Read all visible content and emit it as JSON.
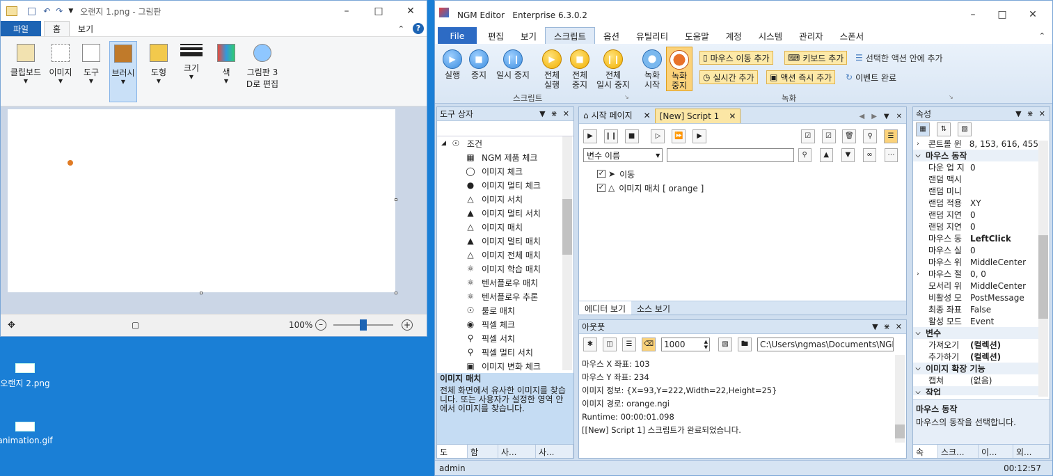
{
  "desktop": {
    "icons": [
      {
        "label": "오랜지 2.png"
      },
      {
        "label": "animation.gif"
      }
    ]
  },
  "paint": {
    "title": "오랜지 1.png - 그림판",
    "tabs": {
      "file": "파일",
      "home": "홈",
      "view": "보기"
    },
    "ribbon": {
      "clipboard": "클립보드",
      "image": "이미지",
      "tools": "도구",
      "brushes": "브러시",
      "shapes": "도형",
      "size": "크기",
      "colors": "색",
      "paint3d_line1": "그림판 3",
      "paint3d_line2": "D로 편집"
    },
    "status": {
      "zoom": "100%"
    },
    "dot_color": "#e07b24"
  },
  "ngm": {
    "title": "NGM Editor   Enterprise 6.3.0.2",
    "menu": [
      "File",
      "편집",
      "보기",
      "스크립트",
      "옵션",
      "유틸리티",
      "도움말",
      "계정",
      "시스템",
      "관리자",
      "스폰서"
    ],
    "ribbon": {
      "run": "실행",
      "stop": "중지",
      "pause": "일시 중지",
      "run_all_1": "전체",
      "run_all_2": "실행",
      "stop_all_1": "전체",
      "stop_all_2": "중지",
      "pause_all_1": "전체",
      "pause_all_2": "일시 중지",
      "group_script": "스크립트",
      "rec_start_1": "녹화",
      "rec_start_2": "시작",
      "rec_stop_1": "녹화",
      "rec_stop_2": "중지",
      "add_mouse": "마우스 이동 추가",
      "add_keyboard": "키보드 추가",
      "add_in_selected": "선택한 액션 안에 추가",
      "add_realtime": "실시간 추가",
      "add_action_now": "액션 즉시 추가",
      "event_done": "이벤트 완료",
      "group_record": "녹화"
    },
    "toolbox": {
      "title": "도구 상자",
      "root": "조건",
      "items": [
        "NGM 제품 체크",
        "이미지 체크",
        "이미지 멀티 체크",
        "이미지 서치",
        "이미지 멀티 서치",
        "이미지 매치",
        "이미지 멀티 매치",
        "이미지 전체 매치",
        "이미지 학습 매치",
        "텐서플로우 매치",
        "텐서플로우 추론",
        "룰로 매치",
        "픽셀 체크",
        "픽셀 서치",
        "픽셀 멀티 서치",
        "이미지 변화 체크"
      ],
      "desc_title": "이미지 매치",
      "desc_text": "전체 화면에서 유사한 이미지를 찾습니다. 또는 사용자가 설정한 영역 안에서 이미지를 찾습니다.",
      "bottom_tabs": [
        "도",
        "함",
        "사...",
        "사..."
      ]
    },
    "editor": {
      "tabs": [
        "시작 페이지",
        "[New] Script 1"
      ],
      "var_select": "변수 이름",
      "lines": [
        "이동",
        "이미지 매치 [ orange ]"
      ],
      "bottom_tabs": [
        "에디터 보기",
        "소스 보기"
      ]
    },
    "output": {
      "title": "아웃풋",
      "count": "1000",
      "path": "C:\\Users\\ngmas\\Documents\\NGM6\\",
      "lines": [
        "마우스 X 좌표: 103",
        "마우스 Y 좌표: 234",
        "이미지 정보: {X=93,Y=222,Width=22,Height=25}",
        "이미지 경로: orange.ngi",
        "Runtime: 00:00:01.098",
        "[[New] Script 1] 스크립트가 완료되었습니다."
      ]
    },
    "props": {
      "title": "속성",
      "rows": [
        {
          "k": "콘트롤 윈",
          "v": "8, 153, 616, 455",
          "type": "row"
        },
        {
          "k": "마우스 동작",
          "v": "",
          "type": "cat"
        },
        {
          "k": "다운 업 지",
          "v": "0",
          "type": "row"
        },
        {
          "k": "랜덤 맥시",
          "v": "",
          "type": "row"
        },
        {
          "k": "랜덤 미니",
          "v": "",
          "type": "row"
        },
        {
          "k": "랜덤 적용",
          "v": "XY",
          "type": "row"
        },
        {
          "k": "랜덤 지연",
          "v": "0",
          "type": "row"
        },
        {
          "k": "랜덤 지연",
          "v": "0",
          "type": "row"
        },
        {
          "k": "마우스 동",
          "v": "LeftClick",
          "type": "bold"
        },
        {
          "k": "마우스 실",
          "v": "0",
          "type": "row"
        },
        {
          "k": "마우스 위",
          "v": "MiddleCenter",
          "type": "row"
        },
        {
          "k": "마우스 절",
          "v": "0, 0",
          "type": "row"
        },
        {
          "k": "모서리 위",
          "v": "MiddleCenter",
          "type": "row"
        },
        {
          "k": "비활성 모",
          "v": "PostMessage",
          "type": "row"
        },
        {
          "k": "최종 좌표",
          "v": "False",
          "type": "row"
        },
        {
          "k": "활성 모드",
          "v": "Event",
          "type": "row"
        },
        {
          "k": "변수",
          "v": "",
          "type": "cat"
        },
        {
          "k": "가져오기",
          "v": "(컬렉션)",
          "type": "bold"
        },
        {
          "k": "추가하기",
          "v": "(컬렉션)",
          "type": "bold"
        },
        {
          "k": "이미지 확장 기능",
          "v": "",
          "type": "cat"
        },
        {
          "k": "캡쳐",
          "v": "(없음)",
          "type": "row"
        },
        {
          "k": "작업",
          "v": "",
          "type": "cat"
        }
      ],
      "desc_title": "마우스 동작",
      "desc_text": "마우스의 동작을 선택합니다.",
      "bottom_tabs": [
        "속",
        "스크...",
        "이...",
        "외..."
      ]
    },
    "status": {
      "user": "admin",
      "time": "00:12:57"
    }
  }
}
